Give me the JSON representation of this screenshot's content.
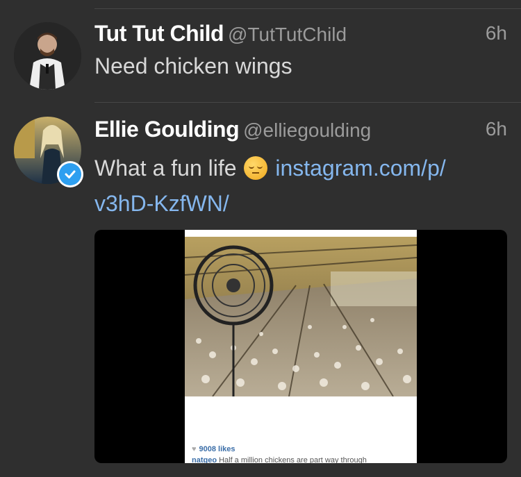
{
  "tweets": [
    {
      "display_name": "Tut Tut Child",
      "handle": "@TutTutChild",
      "time": "6h",
      "text": "Need chicken wings"
    },
    {
      "display_name": "Ellie Goulding",
      "handle": "@elliegoulding",
      "time": "6h",
      "text": "What a fun life",
      "emoji": "pensive-face-emoji",
      "link_line1": "instagram.com/p/",
      "link_line2": "v3hD-KzfWN/",
      "verified": true,
      "media": {
        "likes": "9008 likes",
        "caption_user": "natgeo",
        "caption_text": "Half a million chickens are part way through"
      }
    }
  ],
  "colors": {
    "background": "#2f2f2f",
    "link": "#85b7ee",
    "verified": "#2d9ff0"
  }
}
